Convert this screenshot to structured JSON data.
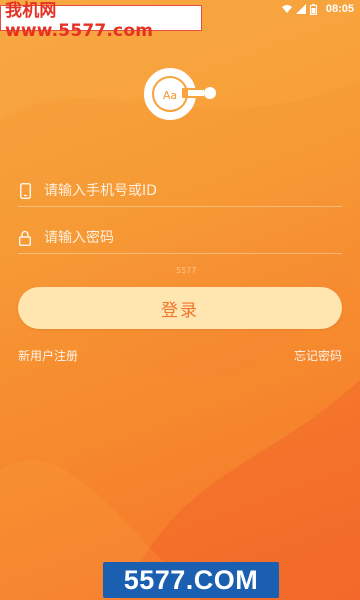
{
  "watermark": {
    "top_text": "我机网 www.5577.com",
    "bottom_text": "5577.COM",
    "center_text": "5577"
  },
  "status_bar": {
    "time": "08:05"
  },
  "logo": {
    "text": "Aa"
  },
  "form": {
    "phone_placeholder": "请输入手机号或ID",
    "password_placeholder": "请输入密码",
    "login_label": "登录"
  },
  "links": {
    "register": "新用户注册",
    "forgot": "忘记密码"
  },
  "colors": {
    "accent": "#f58a30",
    "button_bg": "#ffe6b0",
    "button_text": "#f0762d"
  },
  "icons": [
    "phone-icon",
    "lock-icon",
    "wifi-icon",
    "signal-icon",
    "battery-icon"
  ]
}
